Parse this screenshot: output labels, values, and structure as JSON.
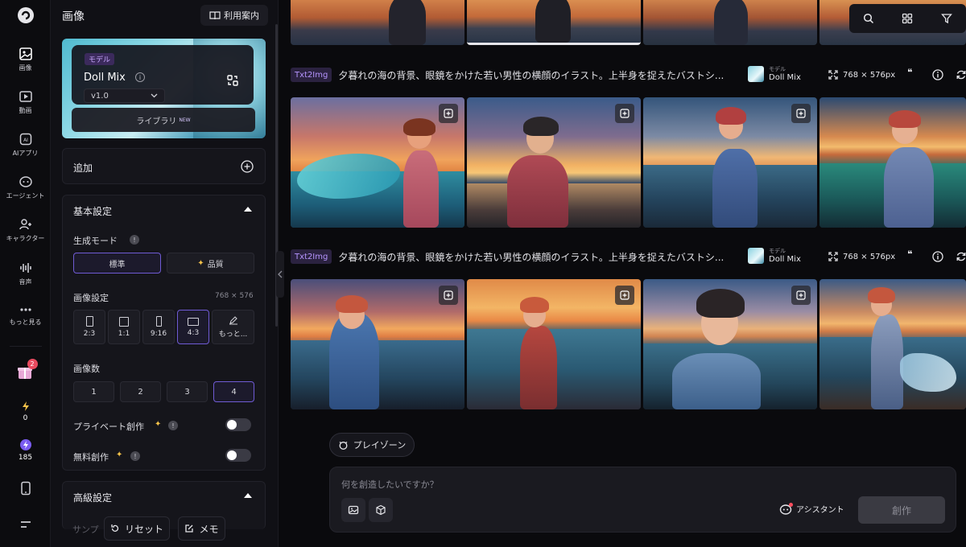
{
  "rail": {
    "items": [
      {
        "label": "画像"
      },
      {
        "label": "動画"
      },
      {
        "label": "AIアプリ"
      },
      {
        "label": "エージェント"
      },
      {
        "label": "キャラクター"
      },
      {
        "label": "音声"
      },
      {
        "label": "もっと見る"
      }
    ],
    "gift_badge": "2",
    "energy_count": "0",
    "credit_count": "185"
  },
  "panel": {
    "title": "画像",
    "guide_label": "利用案内",
    "model": {
      "tag": "モデル",
      "name": "Doll Mix",
      "info": "i",
      "version": "v1.0",
      "library_label": "ライブラリ",
      "library_badge": "NEW"
    },
    "add_label": "追加",
    "basic": {
      "title": "基本設定",
      "mode_label": "生成モード",
      "mode_options": [
        "標準",
        "品質"
      ],
      "image_settings_label": "画像設定",
      "image_size": "768 × 576",
      "ratios": [
        "2:3",
        "1:1",
        "9:16",
        "4:3",
        "もっと..."
      ],
      "count_label": "画像数",
      "counts": [
        "1",
        "2",
        "3",
        "4"
      ],
      "private_label": "プライベート創作",
      "free_label": "無料創作"
    },
    "advanced_title": "高級設定",
    "footer": {
      "partial": "サンプ",
      "reset": "リセット",
      "memo": "メモ"
    }
  },
  "feed": {
    "rows": [
      {
        "tag": "Txt2Img",
        "prompt": "夕暮れの海の背景、眼鏡をかけた若い男性の横顔のイラスト。上半身を捉えたバストシ...",
        "model_caption": "モデル",
        "model_name": "Doll Mix",
        "size": "768 × 576px"
      },
      {
        "tag": "Txt2Img",
        "prompt": "夕暮れの海の背景、眼鏡をかけた若い男性の横顔のイラスト。上半身を捉えたバストシ...",
        "model_caption": "モデル",
        "model_name": "Doll Mix",
        "size": "768 × 576px"
      }
    ]
  },
  "composer": {
    "playzone": "プレイゾーン",
    "placeholder": "何を創造したいですか？",
    "assistant": "アシスタント",
    "create": "創作"
  },
  "colors": {
    "accent": "#6f5bd4",
    "tag_bg": "#2b2240",
    "tag_text": "#b695ff"
  }
}
